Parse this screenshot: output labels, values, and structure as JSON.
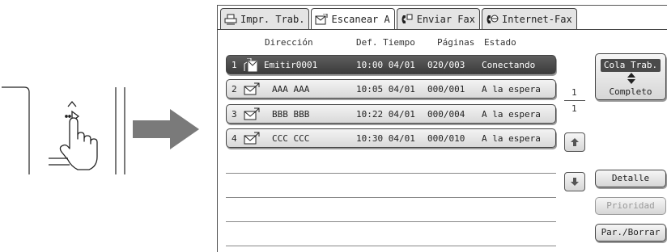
{
  "tabs": [
    {
      "label": "Impr. Trab.",
      "icon": "printer-icon"
    },
    {
      "label": "Escanear A",
      "icon": "scan-icon"
    },
    {
      "label": "Enviar Fax",
      "icon": "fax-icon"
    },
    {
      "label": "Internet-Fax",
      "icon": "internet-fax-icon"
    }
  ],
  "columns": {
    "direccion": "Dirección",
    "def_tiempo": "Def. Tiempo",
    "paginas": "Páginas",
    "estado": "Estado"
  },
  "jobs": [
    {
      "num": "1",
      "name": "Emitir0001",
      "time": "10:00 04/01",
      "pages": "020/003",
      "status": "Conectando",
      "icon": "broadcast-icon"
    },
    {
      "num": "2",
      "name": "AAA AAA",
      "time": "10:05 04/01",
      "pages": "000/001",
      "status": "A la espera",
      "icon": "email-icon"
    },
    {
      "num": "3",
      "name": "BBB BBB",
      "time": "10:22 04/01",
      "pages": "000/004",
      "status": "A la espera",
      "icon": "email-icon"
    },
    {
      "num": "4",
      "name": "CCC CCC",
      "time": "10:30 04/01",
      "pages": "000/010",
      "status": "A la espera",
      "icon": "email-icon"
    }
  ],
  "pager": {
    "current": "1",
    "total": "1"
  },
  "buttons": {
    "job_queue_top": "Cola Trab.",
    "job_queue_bottom": "Completo",
    "detail": "Detalle",
    "priority": "Prioridad",
    "stop_delete": "Par./Borrar"
  },
  "colors": {
    "active_row": "#4a4a4a",
    "disabled_text": "#9a9a9a"
  }
}
